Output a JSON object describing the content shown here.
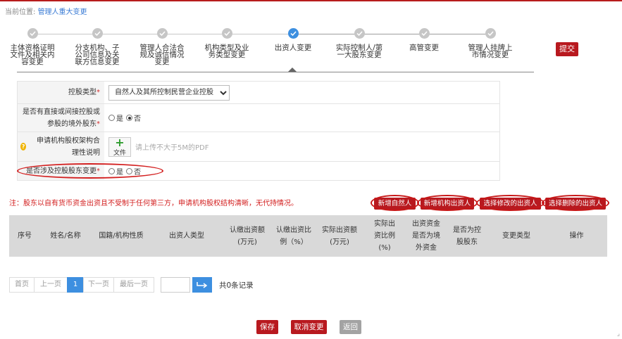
{
  "breadcrumb": {
    "prefix": "当前位置:",
    "current": "管理人重大变更"
  },
  "steps": [
    {
      "label": "主体资格证明文件及相关内容变更",
      "state": "done"
    },
    {
      "label": "分支机构、子公司信息及关联方信息变更",
      "state": "done"
    },
    {
      "label": "管理人合法合规及诚信情况变更",
      "state": "done"
    },
    {
      "label": "机构类型及业务类型变更",
      "state": "done"
    },
    {
      "label": "出资人变更",
      "state": "active"
    },
    {
      "label": "实际控制人/第一大股东变更",
      "state": "todo"
    },
    {
      "label": "高管变更",
      "state": "todo"
    },
    {
      "label": "管理人挂牌上市情况变更",
      "state": "todo"
    }
  ],
  "submit_label": "提交",
  "form": {
    "control_type_label": "控股类型",
    "control_type_value": "自然人及其所控制民营企业控股",
    "foreign_label": "是否有直接或间接控股或参股的境外股东",
    "yes": "是",
    "no": "否",
    "structure_label": "申请机构股权架构合理性说明",
    "upload_label": "文件",
    "upload_hint": "请上传不大于5M的PDF",
    "change_label": "是否涉及控股股东变更",
    "required_mark": "*"
  },
  "note": "注：股东以自有货币资金出资且不受制于任何第三方，申请机构股权结构清晰，无代持情况。",
  "actions": {
    "add_person": "新增自然人",
    "add_org": "新增机构出资人",
    "select_edit": "选择修改的出资人",
    "select_delete": "选择删除的出资人"
  },
  "table_headers": [
    "序号",
    "姓名/名称",
    "国籍/机构性质",
    "出资人类型",
    "认缴出资额(万元)",
    "认缴出资比例（%）",
    "实际出资额(万元)",
    "实际出资比例(%)",
    "出资资金是否为境外资金",
    "是否为控股股东",
    "变更类型",
    "操作"
  ],
  "pager": {
    "first": "首页",
    "prev": "上一页",
    "page": "1",
    "next": "下一页",
    "last": "最后一页",
    "total": "共0条记录"
  },
  "bottom": {
    "save": "保存",
    "cancel": "取消变更",
    "back": "返回"
  },
  "colors": {
    "brand_red": "#b8191f",
    "accent_blue": "#3d8fe0",
    "gray": "#c6c6c6"
  }
}
